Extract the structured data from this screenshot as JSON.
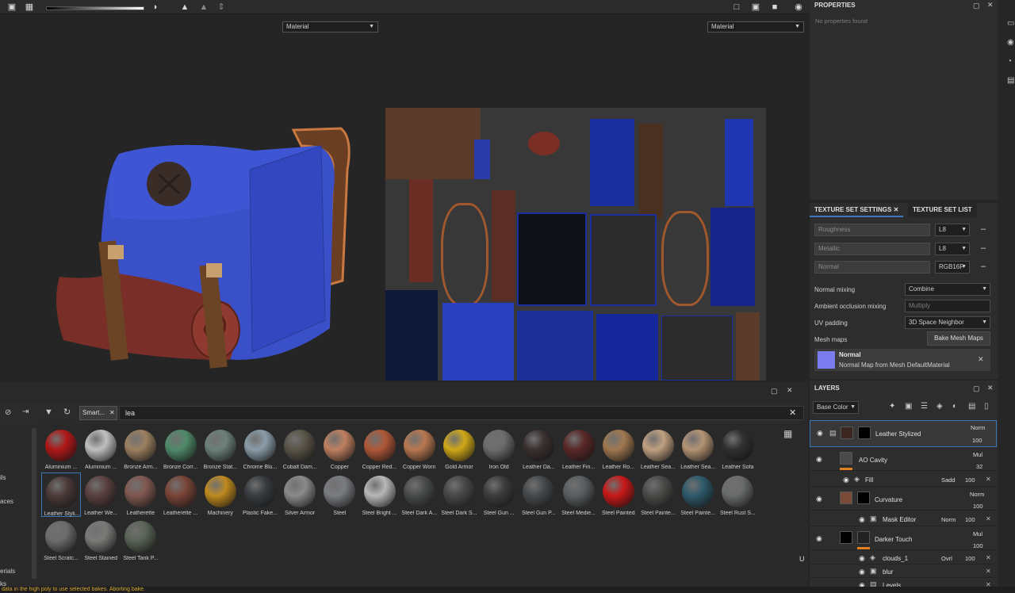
{
  "viewport3d": {
    "channel_select": "Material"
  },
  "viewport2d": {
    "channel_select": "Material"
  },
  "properties": {
    "title": "PROPERTIES",
    "empty_text": "No properties found"
  },
  "texture_set": {
    "tab_settings": "TEXTURE SET SETTINGS",
    "tab_list": "TEXTURE SET LIST",
    "channels": [
      {
        "name": "Roughness",
        "format": "L8"
      },
      {
        "name": "Metallic",
        "format": "L8"
      },
      {
        "name": "Normal",
        "format": "RGB16F"
      }
    ],
    "normal_mixing_label": "Normal mixing",
    "normal_mixing_value": "Combine",
    "ao_mixing_label": "Ambient occlusion mixing",
    "ao_mixing_value": "Multiply",
    "uv_padding_label": "UV padding",
    "uv_padding_value": "3D Space Neighbor",
    "mesh_maps_label": "Mesh maps",
    "bake_button": "Bake Mesh Maps",
    "normal_map_title": "Normal",
    "normal_map_desc": "Normal Map from Mesh DefaultMaterial"
  },
  "layers": {
    "title": "LAYERS",
    "channel_select": "Base Color",
    "rows": [
      {
        "name": "Leather Stylized",
        "blend": "Norm",
        "opacity": "100"
      },
      {
        "name": "AO Cavity",
        "blend": "Mul",
        "opacity": "32"
      },
      {
        "name": "Fill",
        "blend": "Sadd",
        "opacity": "100"
      },
      {
        "name": "Curvature",
        "blend": "Norm",
        "opacity": "100"
      },
      {
        "name": "Mask Editor",
        "blend": "Norm",
        "opacity": "100"
      },
      {
        "name": "Darker Touch",
        "blend": "Mul",
        "opacity": "100"
      },
      {
        "name": "clouds_1",
        "blend": "Ovrl",
        "opacity": "100"
      },
      {
        "name": "blur",
        "blend": "",
        "opacity": ""
      },
      {
        "name": "Levels",
        "blend": "",
        "opacity": ""
      }
    ]
  },
  "shelf": {
    "filter_chip": "Smart...",
    "search_value": "lea",
    "left_labels": [
      "ils",
      "aces",
      "erials",
      "ks"
    ],
    "items": [
      {
        "name": "Aluminium ...",
        "color": "#b01818"
      },
      {
        "name": "Aluminium ...",
        "color": "#c0c0c0"
      },
      {
        "name": "Bronze Arm...",
        "color": "#9c8060"
      },
      {
        "name": "Bronze Corr...",
        "color": "#4f8a6a"
      },
      {
        "name": "Bronze Stat...",
        "color": "#6c807a"
      },
      {
        "name": "Chrome Blu...",
        "color": "#8a9ca8"
      },
      {
        "name": "Cobalt Dam...",
        "color": "#5a5448"
      },
      {
        "name": "Copper",
        "color": "#c08060"
      },
      {
        "name": "Copper Red...",
        "color": "#b05838"
      },
      {
        "name": "Copper Worn",
        "color": "#b87850"
      },
      {
        "name": "Gold Armor",
        "color": "#d0a818"
      },
      {
        "name": "Iron Old",
        "color": "#6c6c6c"
      },
      {
        "name": "Leather Da...",
        "color": "#3a3030"
      },
      {
        "name": "Leather Fin...",
        "color": "#5a2828"
      },
      {
        "name": "Leather Ro...",
        "color": "#a07850"
      },
      {
        "name": "Leather Sea...",
        "color": "#c0a080"
      },
      {
        "name": "Leather Sea...",
        "color": "#b49474"
      },
      {
        "name": "Leather Sofa",
        "color": "#303030"
      },
      {
        "name": "Leather Styli...",
        "color": "#4a3a38"
      },
      {
        "name": "Leather We...",
        "color": "#5a4040"
      },
      {
        "name": "Leatherette",
        "color": "#805850"
      },
      {
        "name": "Leatherette ...",
        "color": "#7a4438"
      },
      {
        "name": "Machinery",
        "color": "#c08a20"
      },
      {
        "name": "Plastic Fake...",
        "color": "#383c40"
      },
      {
        "name": "Silver Armor",
        "color": "#8a8a8a"
      },
      {
        "name": "Steel",
        "color": "#7a7c80"
      },
      {
        "name": "Steel Bright ...",
        "color": "#b8b8b8"
      },
      {
        "name": "Steel Dark A...",
        "color": "#4a4c4c"
      },
      {
        "name": "Steel Dark S...",
        "color": "#48484a"
      },
      {
        "name": "Steel Gun ...",
        "color": "#3c3c3e"
      },
      {
        "name": "Steel Gun P...",
        "color": "#46494c"
      },
      {
        "name": "Steel Medie...",
        "color": "#5a5e60"
      },
      {
        "name": "Steel Painted",
        "color": "#c81818"
      },
      {
        "name": "Steel Painte...",
        "color": "#4a4a48"
      },
      {
        "name": "Steel Painte...",
        "color": "#2e5a6a"
      },
      {
        "name": "Steel Rust S...",
        "color": "#6a6c6c"
      },
      {
        "name": "Steel Scratc...",
        "color": "#6c6c6c"
      },
      {
        "name": "Steel Stained",
        "color": "#7a7a78"
      },
      {
        "name": "Steel Tank P...",
        "color": "#5a6456"
      }
    ]
  },
  "status_text": "data in the high poly to use selected bakes. Aborting bake."
}
